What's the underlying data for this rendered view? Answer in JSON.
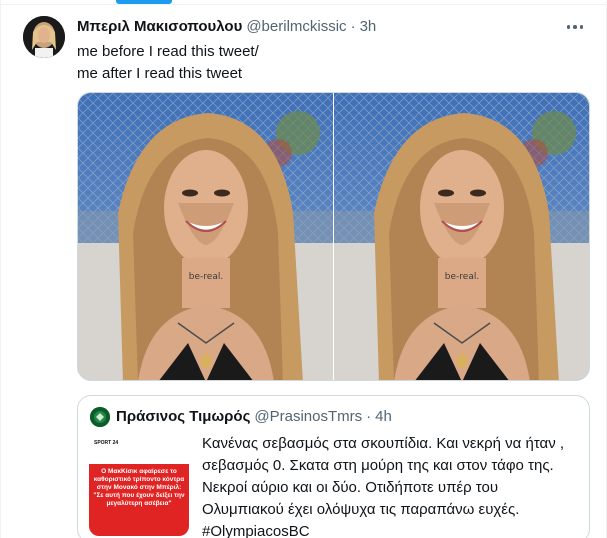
{
  "tweet": {
    "author_name": "Μπεριλ Μακισοπουλου",
    "author_handle": "@berilmckissic",
    "separator": "·",
    "time": "3h",
    "text_line1": "me before I read this tweet/",
    "text_line2": "me after I read this tweet"
  },
  "quoted_tweet": {
    "author_name": "Πράσινος Τιμωρός",
    "author_handle": "@PrasinosTmrs",
    "separator": "·",
    "time": "4h",
    "thumbnail_brand": "SPORT 24",
    "thumbnail_headline": "Ο ΜακΚίσικ αφαίρεσε το καθοριστικό τρίποντο κόντρα στην Μονακό στην Μπέριλ: \"Σε αυτή που έχουν δείξει την μεγαλύτερη ασέβεια\"",
    "text_line1": "Κανένας σεβασμός στα σκουπίδια. Και νεκρή να ήταν ,",
    "text_line2": "σεβασμός 0. Σκατα στη μούρη της και στον τάφο της.",
    "text_line3": "Νεκροί αύριο και οι δύο. Οτιδήποτε υπέρ του",
    "text_line4": "Ολυμπιακού έχει ολόψυχα τις παραπάνω ευχές.",
    "hashtag": "#OlympiacosBC"
  },
  "colors": {
    "accent": "#1d9bf0",
    "text_primary": "#0f1419",
    "text_secondary": "#536471",
    "border": "#cfd9de",
    "thumbnail_red": "#e02424"
  },
  "icons": {
    "more": "more-dots-icon"
  }
}
